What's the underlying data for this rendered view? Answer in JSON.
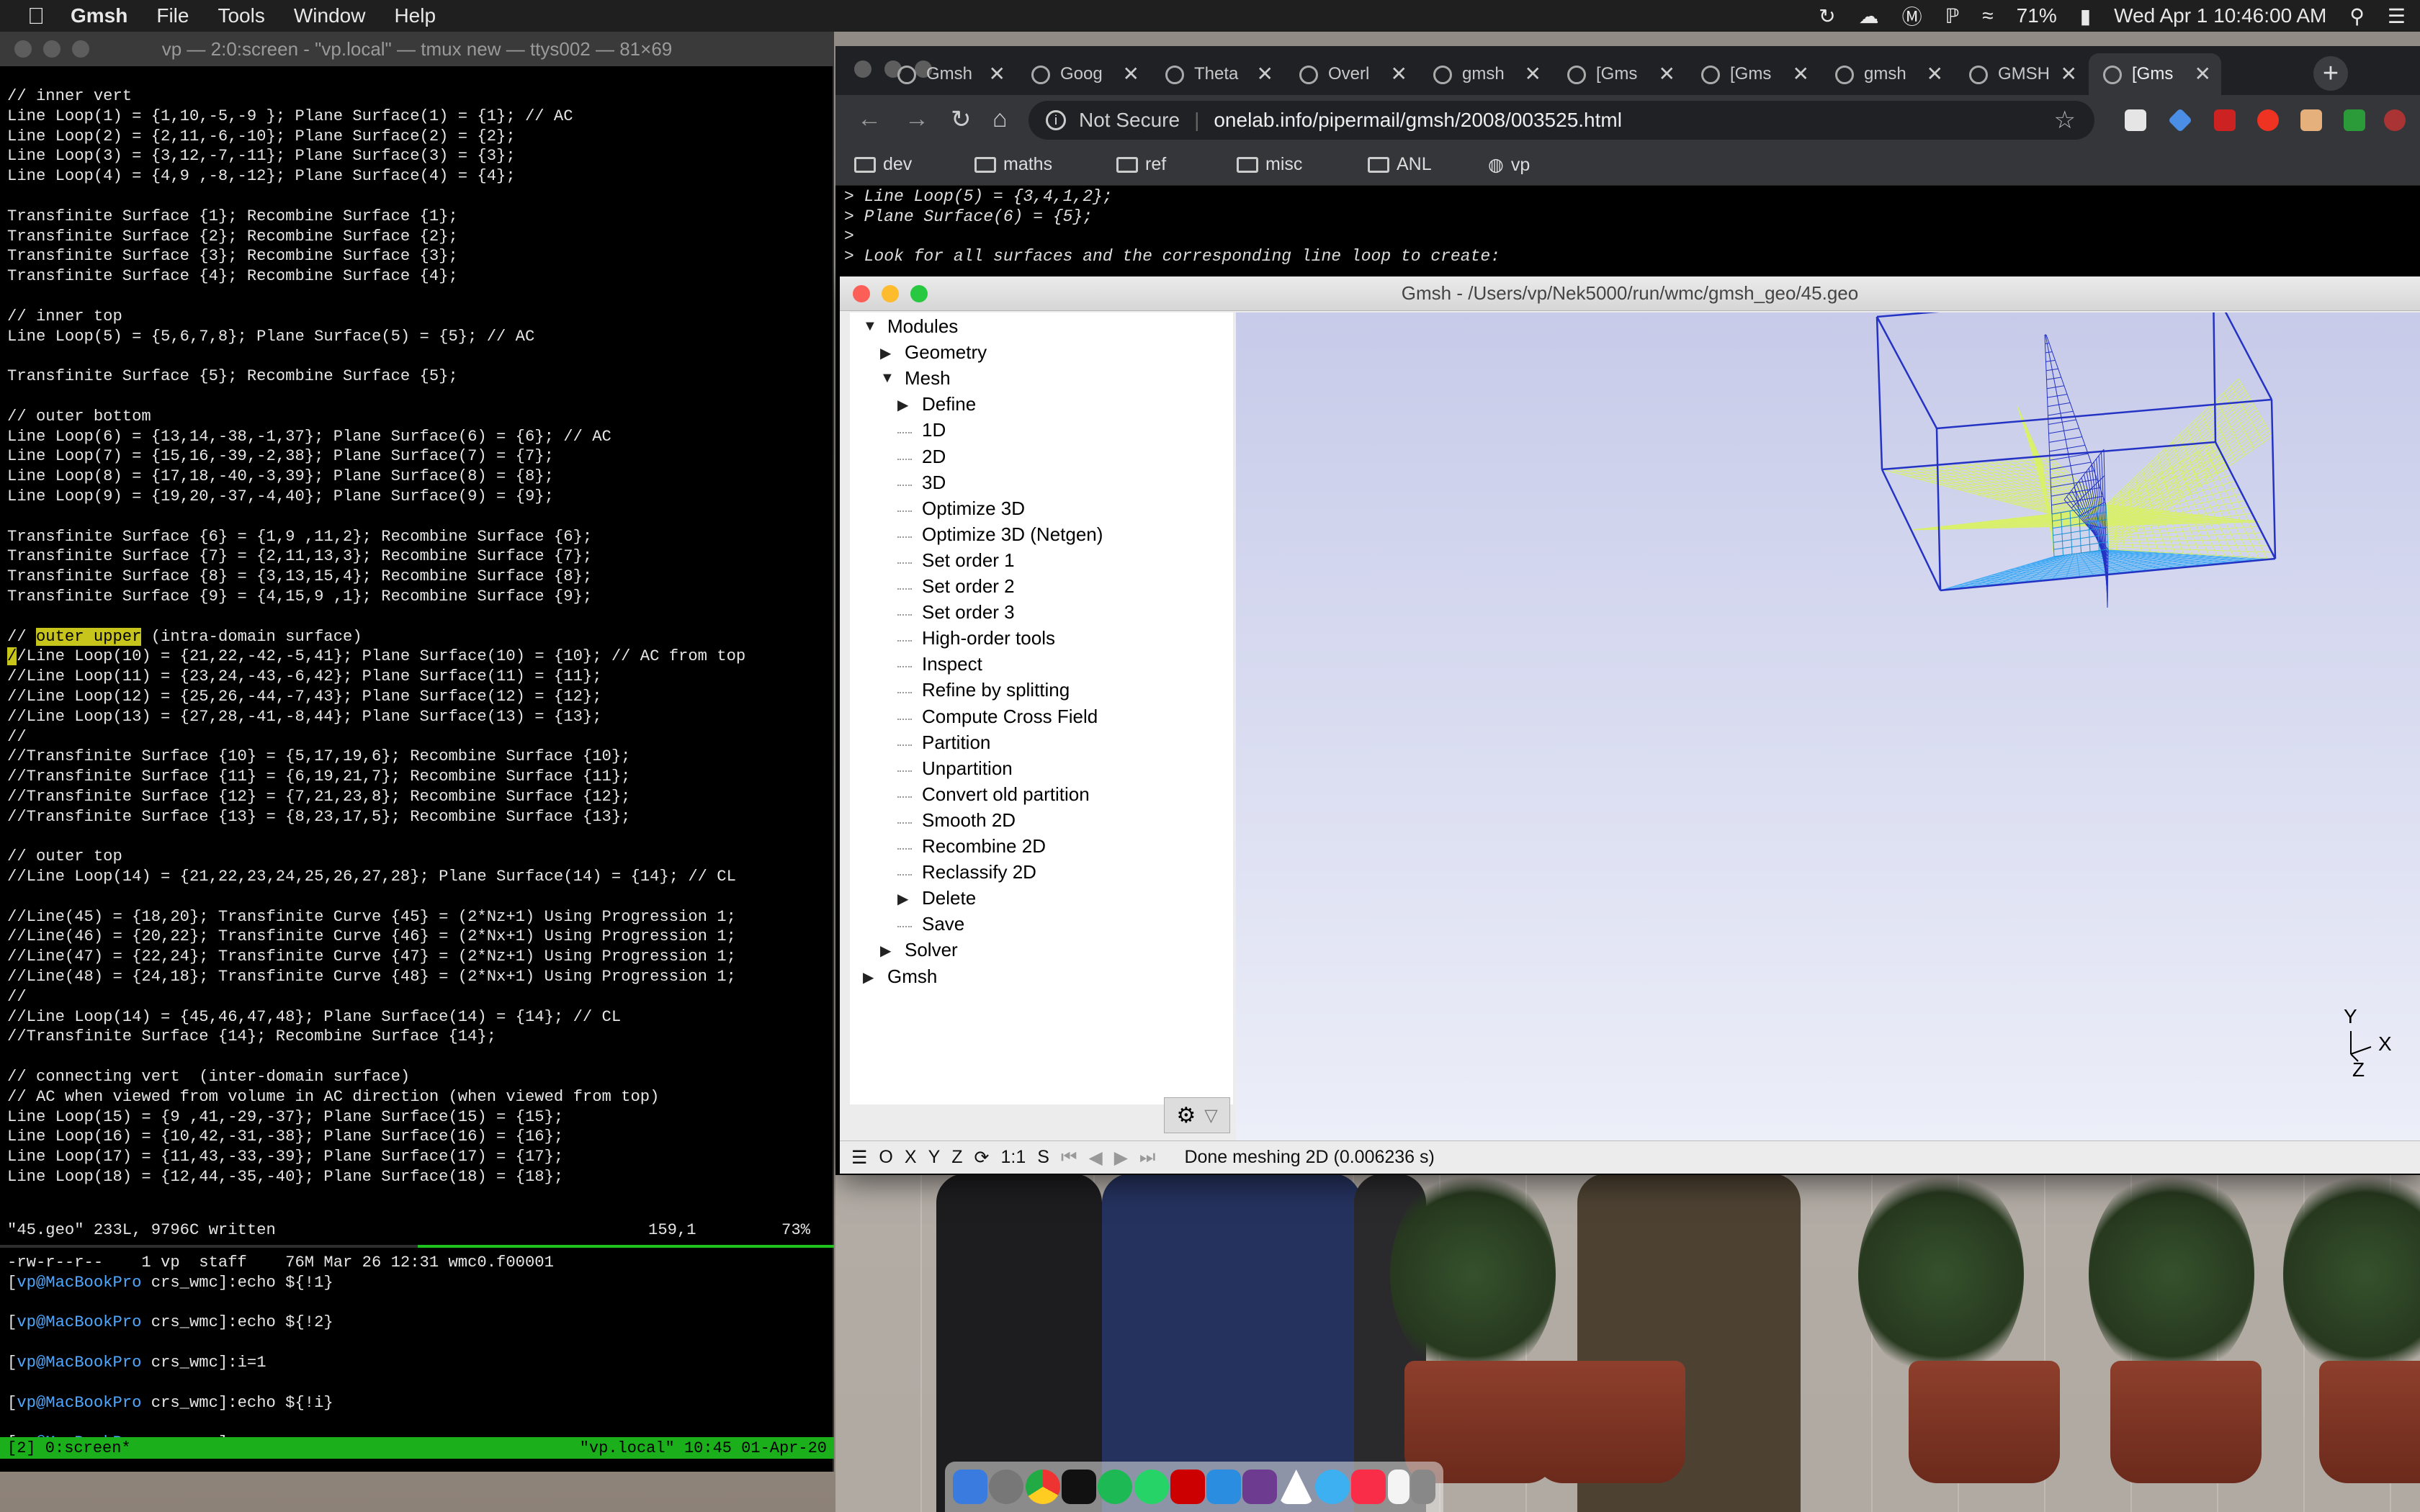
{
  "menubar": {
    "app_name": "Gmsh",
    "menus": [
      "File",
      "Tools",
      "Window",
      "Help"
    ],
    "battery": "71%",
    "clock": "Wed Apr 1  10:46:00 AM"
  },
  "terminal": {
    "title": "vp — 2:0:screen - \"vp.local\" — tmux new — ttys002 — 81×69",
    "lines": [
      "// inner vert",
      "Line Loop(1) = {1,10,-5,-9 }; Plane Surface(1) = {1}; // AC",
      "Line Loop(2) = {2,11,-6,-10}; Plane Surface(2) = {2};",
      "Line Loop(3) = {3,12,-7,-11}; Plane Surface(3) = {3};",
      "Line Loop(4) = {4,9 ,-8,-12}; Plane Surface(4) = {4};",
      "",
      "Transfinite Surface {1}; Recombine Surface {1};",
      "Transfinite Surface {2}; Recombine Surface {2};",
      "Transfinite Surface {3}; Recombine Surface {3};",
      "Transfinite Surface {4}; Recombine Surface {4};",
      "",
      "// inner top",
      "Line Loop(5) = {5,6,7,8}; Plane Surface(5) = {5}; // AC",
      "",
      "Transfinite Surface {5}; Recombine Surface {5};",
      "",
      "// outer bottom",
      "Line Loop(6) = {13,14,-38,-1,37}; Plane Surface(6) = {6}; // AC",
      "Line Loop(7) = {15,16,-39,-2,38}; Plane Surface(7) = {7};",
      "Line Loop(8) = {17,18,-40,-3,39}; Plane Surface(8) = {8};",
      "Line Loop(9) = {19,20,-37,-4,40}; Plane Surface(9) = {9};",
      "",
      "Transfinite Surface {6} = {1,9 ,11,2}; Recombine Surface {6};",
      "Transfinite Surface {7} = {2,11,13,3}; Recombine Surface {7};",
      "Transfinite Surface {8} = {3,13,15,4}; Recombine Surface {8};",
      "Transfinite Surface {9} = {4,15,9 ,1}; Recombine Surface {9};",
      "",
      "@@HL@@",
      "@@CUR@@",
      "//Line Loop(11) = {23,24,-43,-6,42}; Plane Surface(11) = {11};",
      "//Line Loop(12) = {25,26,-44,-7,43}; Plane Surface(12) = {12};",
      "//Line Loop(13) = {27,28,-41,-8,44}; Plane Surface(13) = {13};",
      "//",
      "//Transfinite Surface {10} = {5,17,19,6}; Recombine Surface {10};",
      "//Transfinite Surface {11} = {6,19,21,7}; Recombine Surface {11};",
      "//Transfinite Surface {12} = {7,21,23,8}; Recombine Surface {12};",
      "//Transfinite Surface {13} = {8,23,17,5}; Recombine Surface {13};",
      "",
      "// outer top",
      "//Line Loop(14) = {21,22,23,24,25,26,27,28}; Plane Surface(14) = {14}; // CL",
      "",
      "//Line(45) = {18,20}; Transfinite Curve {45} = (2*Nz+1) Using Progression 1;",
      "//Line(46) = {20,22}; Transfinite Curve {46} = (2*Nx+1) Using Progression 1;",
      "//Line(47) = {22,24}; Transfinite Curve {47} = (2*Nz+1) Using Progression 1;",
      "//Line(48) = {24,18}; Transfinite Curve {48} = (2*Nx+1) Using Progression 1;",
      "//",
      "//Line Loop(14) = {45,46,47,48}; Plane Surface(14) = {14}; // CL",
      "//Transfinite Surface {14}; Recombine Surface {14};",
      "",
      "// connecting vert  (inter-domain surface)",
      "// AC when viewed from volume in AC direction (when viewed from top)",
      "Line Loop(15) = {9 ,41,-29,-37}; Plane Surface(15) = {15};",
      "Line Loop(16) = {10,42,-31,-38}; Plane Surface(16) = {16};",
      "Line Loop(17) = {11,43,-33,-39}; Plane Surface(17) = {17};",
      "Line Loop(18) = {12,44,-35,-40}; Plane Surface(18) = {18};"
    ],
    "hl_prefix": "// ",
    "hl_word": "outer upper",
    "hl_suffix": " (intra-domain surface)",
    "cursor_char": "/",
    "cursor_rest": "/Line Loop(10) = {21,22,-42,-5,41}; Plane Surface(10) = {10}; // AC from top",
    "status_file": "\"45.geo\" 233L, 9796C written",
    "status_pos": "159,1",
    "status_pct": "73%",
    "shell_ls": "-rw-r--r--    1 vp  staff    76M Mar 26 12:31 wmc0.f00001",
    "prompt_user": "vp@MacBookPro",
    "prompt_dir": " crs_wmc]:",
    "commands": [
      "echo ${!1}",
      "echo ${!2}",
      "i=1",
      "echo ${!i}",
      ""
    ],
    "tmux_left": "[2] 0:screen*",
    "tmux_right": "\"vp.local\" 10:45 01-Apr-20"
  },
  "chrome": {
    "tabs": [
      "Gmsh",
      "Goog",
      "Theta",
      "Overl",
      "gmsh",
      "[Gms",
      "[Gms",
      "gmsh",
      "GMSH",
      "[Gms"
    ],
    "url_security": "Not Secure",
    "url": "onelab.info/pipermail/gmsh/2008/003525.html",
    "bookmarks": [
      "dev",
      "maths",
      "ref",
      "misc",
      "ANL",
      "vp"
    ],
    "page_lines": [
      "> Line Loop(5) = {3,4,1,2};",
      "> Plane Surface(6) = {5};",
      ">",
      "> Look for all surfaces and the corresponding line loop to create:"
    ]
  },
  "gmsh": {
    "title": "Gmsh - /Users/vp/Nek5000/run/wmc/gmsh_geo/45.geo",
    "tree": {
      "modules": "Modules",
      "geometry": "Geometry",
      "mesh": "Mesh",
      "mesh_items": [
        "Define",
        "1D",
        "2D",
        "3D",
        "Optimize 3D",
        "Optimize 3D (Netgen)",
        "Set order 1",
        "Set order 2",
        "Set order 3",
        "High-order tools",
        "Inspect",
        "Refine by splitting",
        "Compute Cross Field",
        "Partition",
        "Unpartition",
        "Convert old partition",
        "Smooth 2D",
        "Recombine 2D",
        "Reclassify 2D",
        "Delete",
        "Save"
      ],
      "solver": "Solver",
      "gmsh": "Gmsh"
    },
    "status_buttons": [
      "O",
      "X",
      "Y",
      "Z",
      "1:1",
      "S"
    ],
    "status_message": "Done meshing 2D (0.006236 s)",
    "axis": {
      "y": "Y",
      "x": "X",
      "z": "Z"
    },
    "colors": {
      "viewport_top": "#c7cbe9",
      "mesh_blue": "#2433c4",
      "mesh_cyan": "#3fa9f5",
      "mesh_yellow": "#d9f06a"
    }
  }
}
